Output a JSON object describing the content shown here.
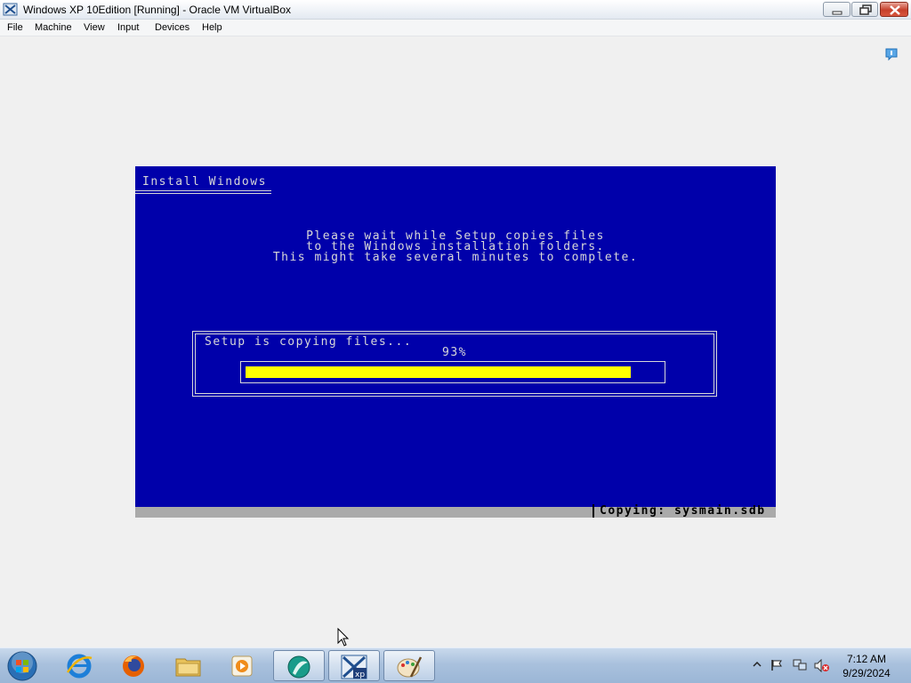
{
  "window": {
    "title": "Windows XP 10Edition [Running] - Oracle VM VirtualBox",
    "app_icon": "virtualbox-icon"
  },
  "menu": {
    "items": [
      "File",
      "Machine",
      "View",
      "Input",
      "Devices",
      "Help"
    ]
  },
  "vm": {
    "heading": "Install Windows",
    "message_lines": [
      "Please wait while Setup copies files",
      "to the Windows installation folders.",
      "This might take several minutes to complete."
    ],
    "progress": {
      "label": "Setup is copying files...",
      "percent_text": "93%",
      "percent_value": 93,
      "fill_color": "#ffff00"
    },
    "status": "Copying: sysmain.sdb",
    "background_color": "#0000aa"
  },
  "taskbar": {
    "start_icon": "windows-start-orb",
    "pinned": [
      {
        "name": "internet-explorer-icon",
        "active": false
      },
      {
        "name": "firefox-icon",
        "active": false
      },
      {
        "name": "file-explorer-icon",
        "active": false
      },
      {
        "name": "media-player-icon",
        "active": false
      },
      {
        "name": "generic-app-icon",
        "active": true
      },
      {
        "name": "windows-xp-virtualbox-icon",
        "active": true
      },
      {
        "name": "paint-icon",
        "active": true
      }
    ],
    "tray_icons": [
      "show-hidden-icons-icon",
      "action-center-flag-icon",
      "network-icon",
      "volume-muted-icon"
    ],
    "clock": {
      "time": "7:12 AM",
      "date": "9/29/2024"
    }
  }
}
